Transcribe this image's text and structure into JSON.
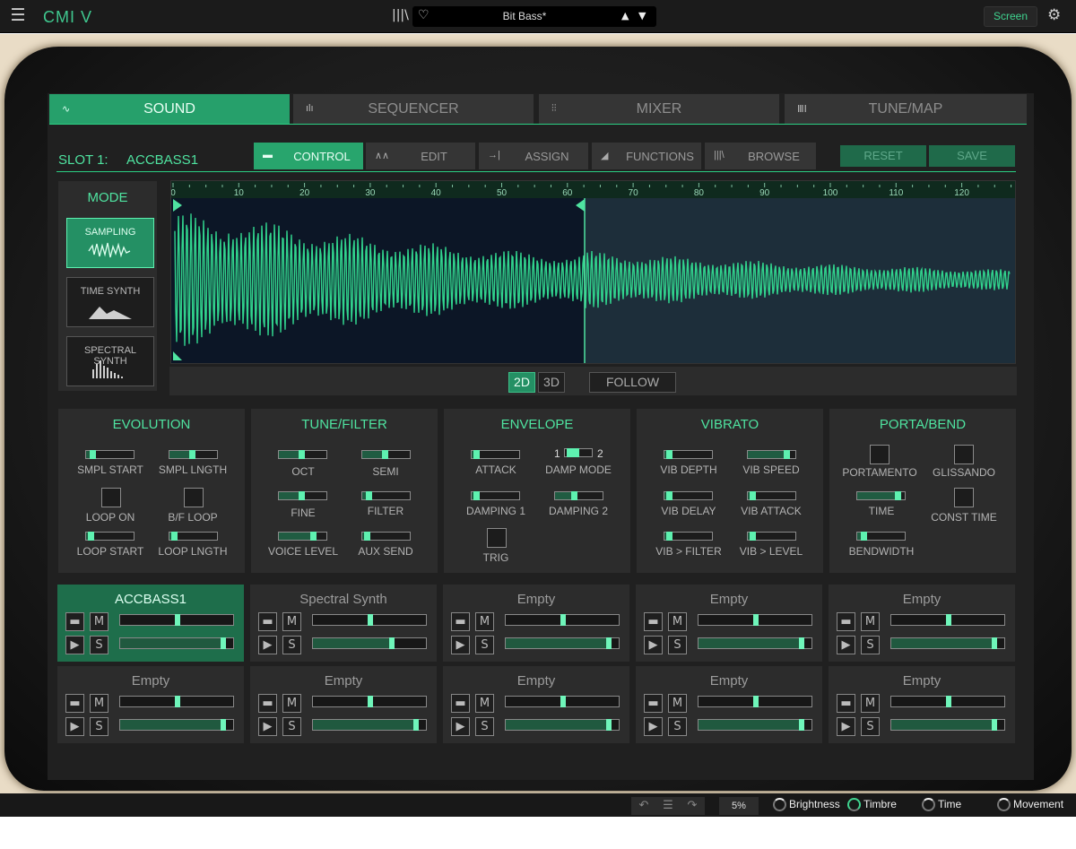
{
  "app": {
    "name": "CMI V"
  },
  "topbar": {
    "preset_name": "Bit Bass*",
    "screen_label": "Screen",
    "prev": "▲",
    "next": "▼"
  },
  "main_tabs": [
    {
      "label": "SOUND",
      "icon": "waveform-icon",
      "active": true
    },
    {
      "label": "SEQUENCER",
      "icon": "bars-icon",
      "active": false
    },
    {
      "label": "MIXER",
      "icon": "faders-icon",
      "active": false
    },
    {
      "label": "TUNE/MAP",
      "icon": "keys-icon",
      "active": false
    }
  ],
  "slot_header": {
    "label": "SLOT 1:",
    "name": "ACCBASS1"
  },
  "sub_tabs": [
    {
      "label": "CONTROL",
      "active": true
    },
    {
      "label": "EDIT",
      "active": false
    },
    {
      "label": "ASSIGN",
      "active": false
    },
    {
      "label": "FUNCTIONS",
      "active": false
    },
    {
      "label": "BROWSE",
      "active": false
    }
  ],
  "actions": {
    "reset": "RESET",
    "save": "SAVE"
  },
  "mode": {
    "title": "MODE",
    "options": [
      {
        "label": "SAMPLING",
        "active": true
      },
      {
        "label": "TIME SYNTH",
        "active": false
      },
      {
        "label": "SPECTRAL SYNTH",
        "active": false
      }
    ]
  },
  "waveform": {
    "ruler": [
      "0",
      "10",
      "20",
      "30",
      "40",
      "50",
      "60",
      "70",
      "80",
      "90",
      "100",
      "110",
      "120"
    ],
    "loop_end": 61
  },
  "view": {
    "btn_2d": "2D",
    "btn_3d": "3D",
    "follow": "FOLLOW"
  },
  "panels": {
    "evolution": {
      "title": "EVOLUTION",
      "smpl_start": "SMPL START",
      "smpl_length": "SMPL LNGTH",
      "loop_on": "LOOP ON",
      "bf_loop": "B/F LOOP",
      "loop_start": "LOOP START",
      "loop_length": "LOOP LNGTH"
    },
    "tune": {
      "title": "TUNE/FILTER",
      "oct": "OCT",
      "semi": "SEMI",
      "fine": "FINE",
      "filter": "FILTER",
      "voice_level": "VOICE LEVEL",
      "aux_send": "AUX SEND"
    },
    "envelope": {
      "title": "ENVELOPE",
      "attack": "ATTACK",
      "damp_mode": "DAMP MODE",
      "damp_1": "1",
      "damp_2": "2",
      "damping1": "DAMPING 1",
      "damping2": "DAMPING 2",
      "trig": "TRIG"
    },
    "vibrato": {
      "title": "VIBRATO",
      "vib_depth": "VIB DEPTH",
      "vib_speed": "VIB SPEED",
      "vib_delay": "VIB DELAY",
      "vib_attack": "VIB ATTACK",
      "vib_filter": "VIB > FILTER",
      "vib_level": "VIB > LEVEL"
    },
    "porta": {
      "title": "PORTA/BEND",
      "portamento": "PORTAMENTO",
      "glissando": "GLISSANDO",
      "time": "TIME",
      "const_time": "CONST TIME",
      "bendwidth": "BENDWIDTH"
    }
  },
  "slider_values": {
    "smpl_start": 0.1,
    "smpl_length": 0.5,
    "loop_start": 0.05,
    "loop_length": 0.05,
    "oct": 0.5,
    "semi": 0.5,
    "fine": 0.5,
    "filter": 0.1,
    "voice_level": 0.8,
    "aux_send": 0.05,
    "attack": 0.05,
    "damping1": 0.05,
    "damping2": 0.4,
    "vib_depth": 0.05,
    "vib_speed": 0.9,
    "vib_delay": 0.05,
    "vib_attack": 0.05,
    "vib_filter": 0.05,
    "vib_level": 0.05,
    "time": 0.95,
    "bendwidth": 0.1
  },
  "slots": [
    {
      "name": "ACCBASS1",
      "active": true,
      "pan": 0.5,
      "level": 0.92
    },
    {
      "name": "Spectral Synth",
      "active": false,
      "pan": 0.5,
      "level": 0.7
    },
    {
      "name": "Empty",
      "active": false,
      "pan": 0.5,
      "level": 0.92
    },
    {
      "name": "Empty",
      "active": false,
      "pan": 0.5,
      "level": 0.92
    },
    {
      "name": "Empty",
      "active": false,
      "pan": 0.5,
      "level": 0.92
    },
    {
      "name": "Empty",
      "active": false,
      "pan": 0.5,
      "level": 0.92
    },
    {
      "name": "Empty",
      "active": false,
      "pan": 0.5,
      "level": 0.92
    },
    {
      "name": "Empty",
      "active": false,
      "pan": 0.5,
      "level": 0.92
    },
    {
      "name": "Empty",
      "active": false,
      "pan": 0.5,
      "level": 0.92
    },
    {
      "name": "Empty",
      "active": false,
      "pan": 0.5,
      "level": 0.92
    }
  ],
  "slot_buttons": {
    "mute": "M",
    "solo": "S",
    "folder": "▬",
    "play": "▶"
  },
  "bottombar": {
    "zoom": "5%",
    "macros": [
      "Brightness",
      "Timbre",
      "Time",
      "Movement"
    ]
  },
  "colors": {
    "accent": "#3fd38f",
    "panel": "#2c2c2c",
    "active_tab": "#26a06b"
  }
}
